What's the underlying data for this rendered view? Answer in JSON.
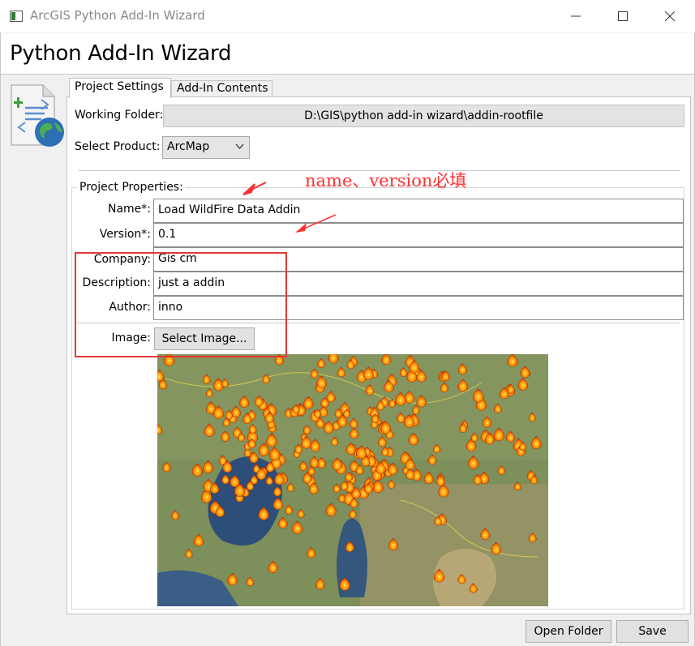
{
  "window": {
    "title": "ArcGIS Python Add-In Wizard",
    "controls": [
      "minimize-icon",
      "maximize-icon",
      "close-icon"
    ]
  },
  "header": {
    "title": "Python Add-In Wizard"
  },
  "tabs": [
    {
      "label": "Project Settings",
      "selected": true
    },
    {
      "label": "Add-In Contents",
      "selected": false
    }
  ],
  "project_settings": {
    "working_folder_label": "Working Folder:",
    "working_folder_value": "D:\\GIS\\python add-in wizard\\addin-rootfile",
    "select_product_label": "Select Product:",
    "product_selected": "ArcMap",
    "properties_legend": "Project Properties:",
    "fields": {
      "name": {
        "label": "Name*:",
        "value": "Load WildFire Data Addin"
      },
      "version": {
        "label": "Version*:",
        "value": "0.1"
      },
      "company": {
        "label": "Company:",
        "value": "Gis cm"
      },
      "description": {
        "label": "Description:",
        "value": "just a addin"
      },
      "author": {
        "label": "Author:",
        "value": "inno"
      }
    },
    "image_label": "Image:",
    "select_image_button": "Select Image..."
  },
  "annotation": {
    "text": "name、version必填",
    "color": "#ff3030"
  },
  "footer": {
    "open_folder": "Open Folder",
    "save": "Save"
  },
  "icons": {
    "app": "window-app-icon",
    "logo": "python-addin-globe-icon",
    "product_dropdown": "chevron-down-icon"
  }
}
